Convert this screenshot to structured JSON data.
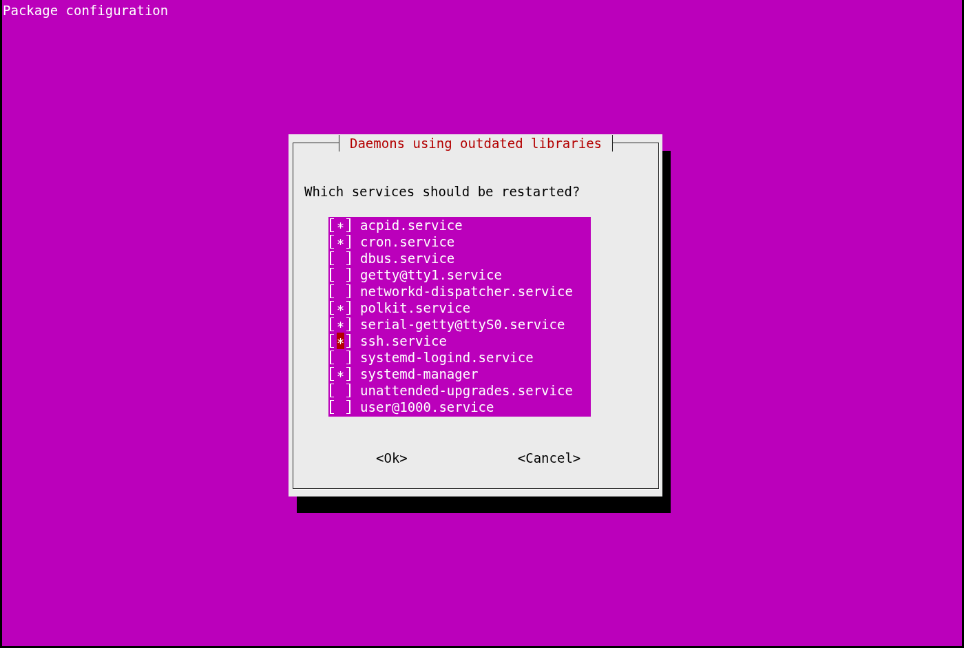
{
  "screen_title": "Package configuration",
  "dialog": {
    "title": "Daemons using outdated libraries",
    "prompt": "Which services should be restarted?",
    "services": [
      {
        "label": "acpid.service",
        "checked": true,
        "focused": false
      },
      {
        "label": "cron.service",
        "checked": true,
        "focused": false
      },
      {
        "label": "dbus.service",
        "checked": false,
        "focused": false
      },
      {
        "label": "getty@tty1.service",
        "checked": false,
        "focused": false
      },
      {
        "label": "networkd-dispatcher.service",
        "checked": false,
        "focused": false
      },
      {
        "label": "polkit.service",
        "checked": true,
        "focused": false
      },
      {
        "label": "serial-getty@ttyS0.service",
        "checked": true,
        "focused": false
      },
      {
        "label": "ssh.service",
        "checked": true,
        "focused": true
      },
      {
        "label": "systemd-logind.service",
        "checked": false,
        "focused": false
      },
      {
        "label": "systemd-manager",
        "checked": true,
        "focused": false
      },
      {
        "label": "unattended-upgrades.service",
        "checked": false,
        "focused": false
      },
      {
        "label": "user@1000.service",
        "checked": false,
        "focused": false
      }
    ],
    "buttons": [
      "<Ok>",
      "<Cancel>"
    ]
  }
}
